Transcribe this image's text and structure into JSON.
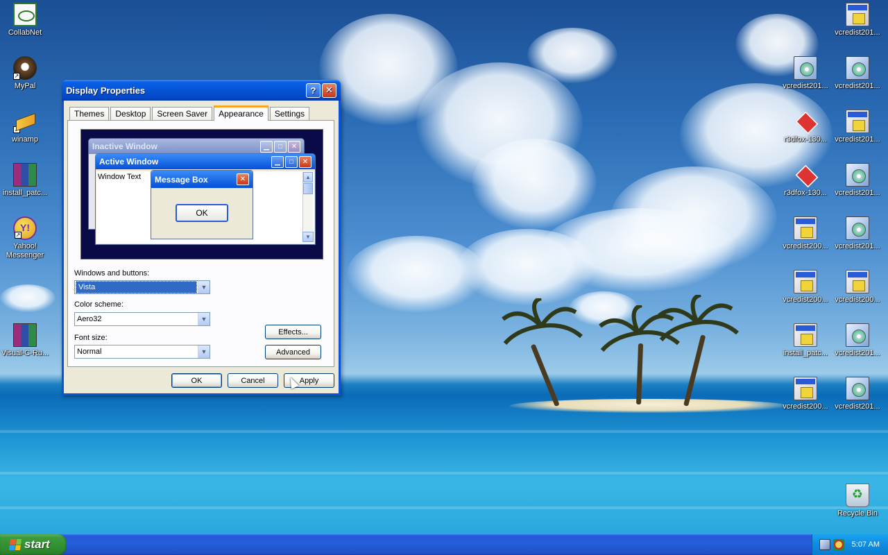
{
  "desktop": {
    "left_icons": [
      {
        "label": "CollabNet",
        "icon": "collabnet-icon"
      },
      {
        "label": "MyPal",
        "icon": "mypal-icon"
      },
      {
        "label": "winamp",
        "icon": "winamp-icon"
      },
      {
        "label": "install_patc...",
        "icon": "winrar-archive-icon"
      },
      {
        "label": "Yahoo! Messenger",
        "icon": "yahoo-messenger-icon"
      },
      {
        "label": "Visual-C-Ru...",
        "icon": "winrar-archive-icon"
      }
    ],
    "right_icons": [
      {
        "label": "vcredist201...",
        "icon": "installer-icon"
      },
      {
        "label": "vcredist201...",
        "icon": "installer-cd-icon"
      },
      {
        "label": "vcredist201...",
        "icon": "installer-cd-icon"
      },
      {
        "label": "r3dfox-130...",
        "icon": "firefox-icon"
      },
      {
        "label": "vcredist201...",
        "icon": "installer-icon"
      },
      {
        "label": "r3dfox-130...",
        "icon": "firefox-icon"
      },
      {
        "label": "vcredist201...",
        "icon": "installer-cd-icon"
      },
      {
        "label": "vcredist200...",
        "icon": "installer-icon"
      },
      {
        "label": "vcredist201...",
        "icon": "installer-cd-icon"
      },
      {
        "label": "vcredist200...",
        "icon": "installer-icon"
      },
      {
        "label": "vcredist200...",
        "icon": "installer-icon"
      },
      {
        "label": "install_patc...",
        "icon": "gear-window-icon"
      },
      {
        "label": "vcredist201...",
        "icon": "installer-cd-icon"
      },
      {
        "label": "vcredist200...",
        "icon": "installer-icon"
      },
      {
        "label": "vcredist201...",
        "icon": "installer-cd-icon"
      }
    ],
    "recycle_bin": {
      "label": "Recycle Bin",
      "icon": "recycle-bin-icon"
    }
  },
  "dialog": {
    "title": "Display Properties",
    "help_glyph": "?",
    "close_glyph": "✕",
    "tabs": [
      {
        "label": "Themes",
        "active": false
      },
      {
        "label": "Desktop",
        "active": false
      },
      {
        "label": "Screen Saver",
        "active": false
      },
      {
        "label": "Appearance",
        "active": true
      },
      {
        "label": "Settings",
        "active": false
      }
    ],
    "preview": {
      "inactive_title": "Inactive Window",
      "active_title": "Active Window",
      "window_text": "Window Text",
      "message_box_title": "Message Box",
      "message_box_ok": "OK",
      "minimize_glyph": "▁",
      "maximize_glyph": "□",
      "close_glyph": "✕",
      "scroll_up": "▲",
      "scroll_down": "▼"
    },
    "windows_buttons": {
      "label": "Windows and buttons:",
      "value": "Vista"
    },
    "color_scheme": {
      "label": "Color scheme:",
      "value": "Aero32"
    },
    "font_size": {
      "label": "Font size:",
      "value": "Normal"
    },
    "dropdown_glyph": "▼",
    "effects_button": "Effects...",
    "advanced_button": "Advanced",
    "ok_button": "OK",
    "cancel_button": "Cancel",
    "apply_button": "Apply"
  },
  "taskbar": {
    "start_label": "start",
    "clock": "5:07 AM",
    "tray_icons": [
      "network-icon",
      "security-shield-icon"
    ]
  },
  "colors": {
    "titlebar_blue": "#0653d6",
    "start_green": "#3d9b3d",
    "tab_active_accent": "#f5a623",
    "dialog_face": "#ece9d8"
  }
}
